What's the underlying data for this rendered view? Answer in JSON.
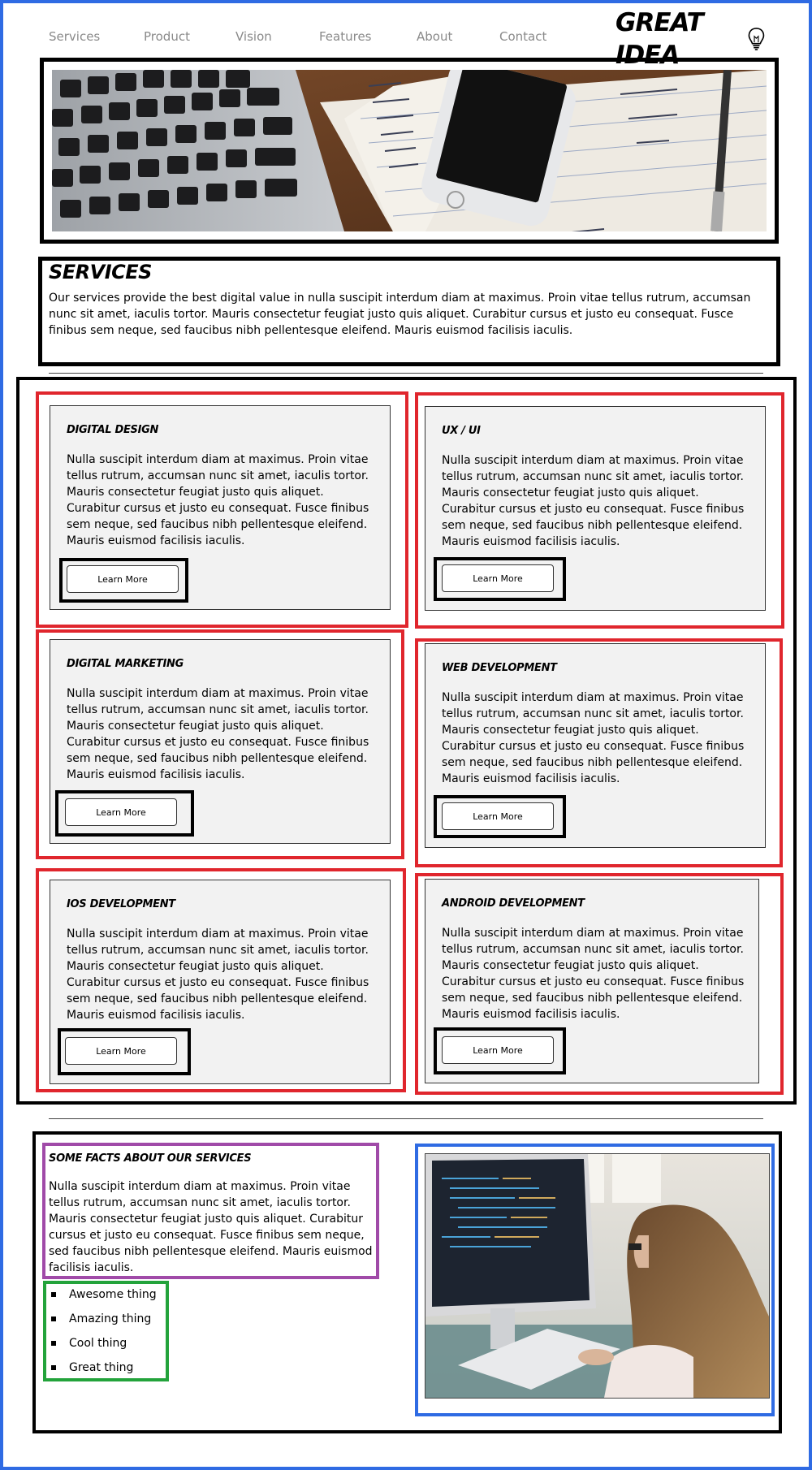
{
  "nav": {
    "items": [
      "Services",
      "Product",
      "Vision",
      "Features",
      "About",
      "Contact"
    ],
    "logo_text": "GREAT IDEA"
  },
  "intro": {
    "title": "SERVICES",
    "body": "Our services provide the best digital value in nulla suscipit interdum diam at maximus. Proin vitae tellus rutrum, accumsan nunc sit amet, iaculis tortor. Mauris consectetur feugiat justo quis aliquet. Curabitur cursus et justo eu consequat. Fusce finibus sem neque, sed faucibus nibh pellentesque eleifend. Mauris euismod facilisis iaculis."
  },
  "cards": [
    {
      "title": "DIGITAL DESIGN",
      "body": "Nulla suscipit interdum diam at maximus. Proin vitae tellus rutrum, accumsan nunc sit amet, iaculis tortor. Mauris consectetur feugiat justo quis aliquet. Curabitur cursus et justo eu consequat. Fusce finibus sem neque, sed faucibus nibh pellentesque eleifend. Mauris euismod facilisis iaculis.",
      "button": "Learn More"
    },
    {
      "title": "UX / UI",
      "body": "Nulla suscipit interdum diam at maximus. Proin vitae tellus rutrum, accumsan nunc sit amet, iaculis tortor. Mauris consectetur feugiat justo quis aliquet. Curabitur cursus et justo eu consequat. Fusce finibus sem neque, sed faucibus nibh pellentesque eleifend. Mauris euismod facilisis iaculis.",
      "button": "Learn More"
    },
    {
      "title": "DIGITAL MARKETING",
      "body": "Nulla suscipit interdum diam at maximus. Proin vitae tellus rutrum, accumsan nunc sit amet, iaculis tortor. Mauris consectetur feugiat justo quis aliquet. Curabitur cursus et justo eu consequat. Fusce finibus sem neque, sed faucibus nibh pellentesque eleifend. Mauris euismod facilisis iaculis.",
      "button": "Learn More"
    },
    {
      "title": "WEB DEVELOPMENT",
      "body": "Nulla suscipit interdum diam at maximus. Proin vitae tellus rutrum, accumsan nunc sit amet, iaculis tortor. Mauris consectetur feugiat justo quis aliquet. Curabitur cursus et justo eu consequat. Fusce finibus sem neque, sed faucibus nibh pellentesque eleifend. Mauris euismod facilisis iaculis.",
      "button": "Learn More"
    },
    {
      "title": "IOS DEVELOPMENT",
      "body": "Nulla suscipit interdum diam at maximus. Proin vitae tellus rutrum, accumsan nunc sit amet, iaculis tortor. Mauris consectetur feugiat justo quis aliquet. Curabitur cursus et justo eu consequat. Fusce finibus sem neque, sed faucibus nibh pellentesque eleifend. Mauris euismod facilisis iaculis.",
      "button": "Learn More"
    },
    {
      "title": "ANDROID DEVELOPMENT",
      "body": "Nulla suscipit interdum diam at maximus. Proin vitae tellus rutrum, accumsan nunc sit amet, iaculis tortor. Mauris consectetur feugiat justo quis aliquet. Curabitur cursus et justo eu consequat. Fusce finibus sem neque, sed faucibus nibh pellentesque eleifend. Mauris euismod facilisis iaculis.",
      "button": "Learn More"
    }
  ],
  "facts": {
    "title": "SOME FACTS ABOUT OUR SERVICES",
    "body": "Nulla suscipit interdum diam at maximus. Proin vitae tellus rutrum, accumsan nunc sit amet, iaculis tortor. Mauris consectetur feugiat justo quis aliquet. Curabitur cursus et justo eu consequat. Fusce finibus sem neque, sed faucibus nibh pellentesque eleifend. Mauris euismod facilisis iaculis.",
    "list": [
      "Awesome thing",
      "Amazing thing",
      "Cool thing",
      "Great thing"
    ]
  },
  "colors": {
    "page_frame": "#2f6be3",
    "card_outline": "#e0262d",
    "facts_text_outline": "#a04aa8",
    "list_outline": "#23a33b",
    "photo_outline": "#2f6be3",
    "card_background": "#f2f2f2",
    "nav_text": "#8a8a8a"
  },
  "images": {
    "hero": "desk-photo-laptop-phone-notebook",
    "facts": "woman-coding-at-computer-photo"
  },
  "icons": {
    "logo": "lightbulb-icon"
  }
}
